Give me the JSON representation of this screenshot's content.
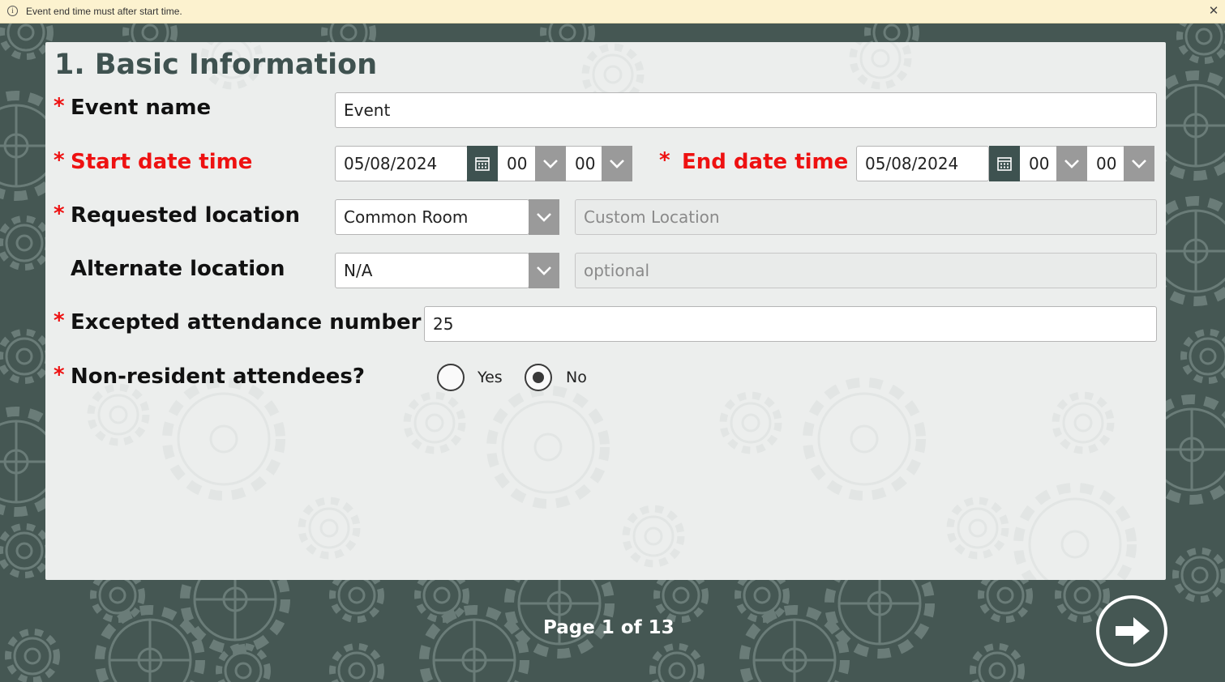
{
  "notification": {
    "message": "Event end time must after start time.",
    "info_icon": "info-icon",
    "close_icon": "close-icon"
  },
  "section": {
    "title": "1. Basic Information"
  },
  "fields": {
    "required_marker": "*",
    "event_name": {
      "label": "Event name",
      "value": "Event"
    },
    "start": {
      "label": "Start date time",
      "date": "05/08/2024",
      "hour": "00",
      "minute": "00"
    },
    "end": {
      "label": "End date time",
      "date": "05/08/2024",
      "hour": "00",
      "minute": "00"
    },
    "requested_location": {
      "label": "Requested location",
      "value": "Common Room",
      "custom_placeholder": "Custom Location"
    },
    "alternate_location": {
      "label": "Alternate location",
      "value": "N/A",
      "custom_placeholder": "optional"
    },
    "attendance": {
      "label": "Excepted attendance number",
      "value": "25"
    },
    "non_resident": {
      "label": "Non-resident attendees?",
      "options": [
        {
          "label": "Yes",
          "selected": false
        },
        {
          "label": "No",
          "selected": true
        }
      ]
    }
  },
  "footer": {
    "pager": "Page 1 of 13",
    "next_icon": "arrow-right-icon"
  },
  "colors": {
    "background": "#455753",
    "panel": "#eceeed",
    "accent_dark": "#3e5250",
    "required_red": "#e11111",
    "notification_bg": "#fcf2cf"
  }
}
